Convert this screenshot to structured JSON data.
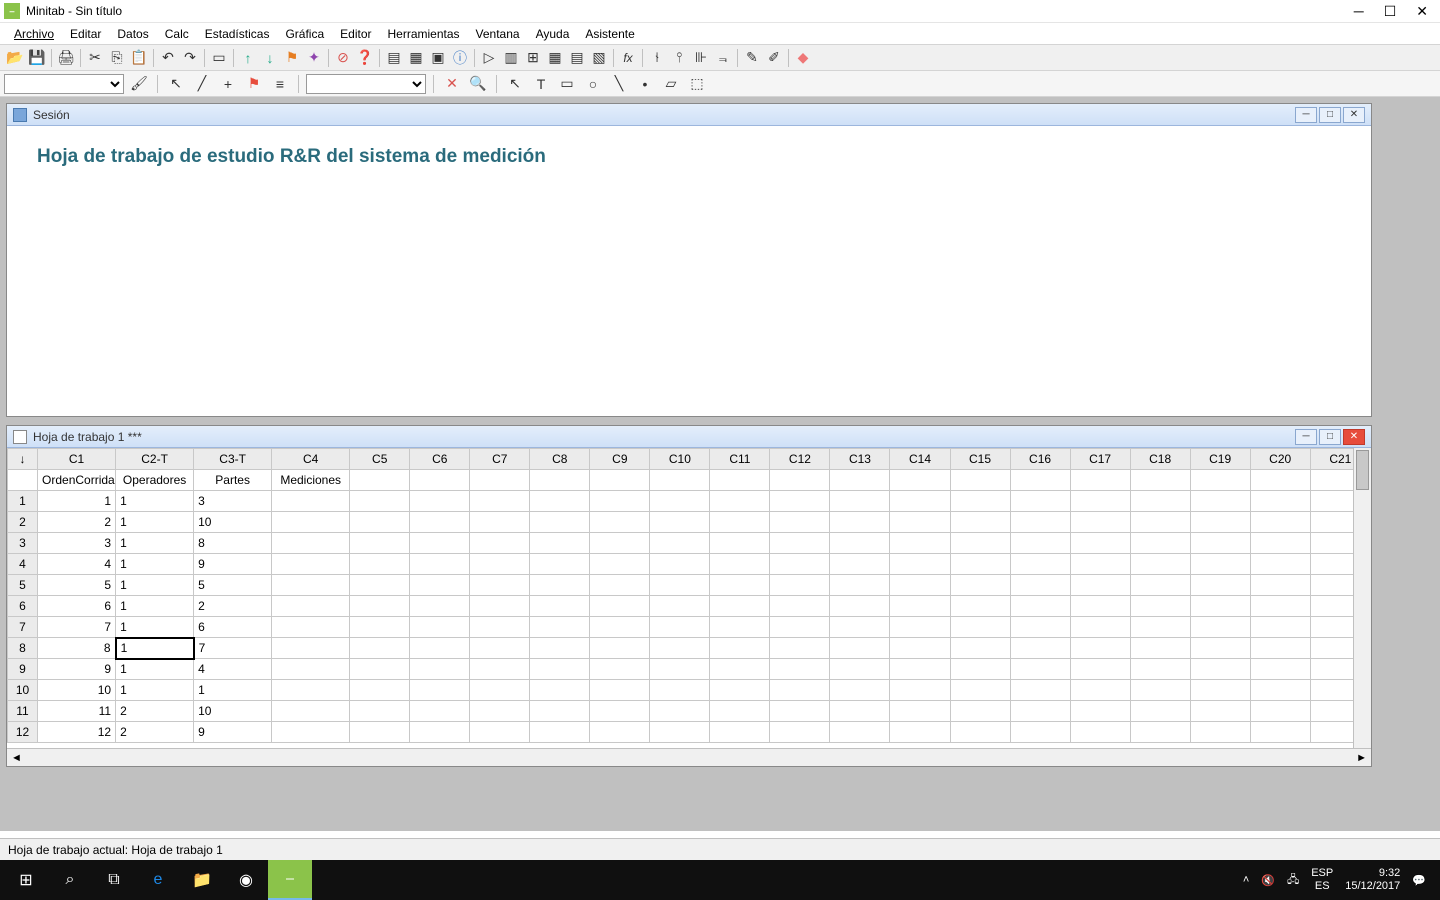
{
  "titlebar": {
    "app": "Minitab",
    "doc": "Sin título"
  },
  "menu": [
    "Archivo",
    "Editar",
    "Datos",
    "Calc",
    "Estadísticas",
    "Gráfica",
    "Editor",
    "Herramientas",
    "Ventana",
    "Ayuda",
    "Asistente"
  ],
  "session": {
    "title": "Sesión",
    "heading": "Hoja de trabajo de estudio R&R del sistema de medición"
  },
  "worksheet": {
    "title": "Hoja de trabajo 1 ***",
    "columns": [
      "C1",
      "C2-T",
      "C3-T",
      "C4",
      "C5",
      "C6",
      "C7",
      "C8",
      "C9",
      "C10",
      "C11",
      "C12",
      "C13",
      "C14",
      "C15",
      "C16",
      "C17",
      "C18",
      "C19",
      "C20",
      "C21"
    ],
    "names": [
      "OrdenCorrida",
      "Operadores",
      "Partes",
      "Mediciones",
      "",
      "",
      "",
      "",
      "",
      "",
      "",
      "",
      "",
      "",
      "",
      "",
      "",
      "",
      "",
      "",
      ""
    ],
    "rows": [
      {
        "n": 1,
        "c1": "1",
        "c2": "1",
        "c3": "3"
      },
      {
        "n": 2,
        "c1": "2",
        "c2": "1",
        "c3": "10"
      },
      {
        "n": 3,
        "c1": "3",
        "c2": "1",
        "c3": "8"
      },
      {
        "n": 4,
        "c1": "4",
        "c2": "1",
        "c3": "9"
      },
      {
        "n": 5,
        "c1": "5",
        "c2": "1",
        "c3": "5"
      },
      {
        "n": 6,
        "c1": "6",
        "c2": "1",
        "c3": "2"
      },
      {
        "n": 7,
        "c1": "7",
        "c2": "1",
        "c3": "6"
      },
      {
        "n": 8,
        "c1": "8",
        "c2": "1",
        "c3": "7"
      },
      {
        "n": 9,
        "c1": "9",
        "c2": "1",
        "c3": "4"
      },
      {
        "n": 10,
        "c1": "10",
        "c2": "1",
        "c3": "1"
      },
      {
        "n": 11,
        "c1": "11",
        "c2": "2",
        "c3": "10"
      },
      {
        "n": 12,
        "c1": "12",
        "c2": "2",
        "c3": "9"
      }
    ],
    "active_cell": {
      "row": 8,
      "col": "C2-T",
      "value": "1"
    }
  },
  "statusbar": {
    "text": "Hoja de trabajo actual: Hoja de trabajo 1"
  },
  "tray": {
    "lang1": "ESP",
    "lang2": "ES",
    "time": "9:32",
    "date": "15/12/2017"
  }
}
